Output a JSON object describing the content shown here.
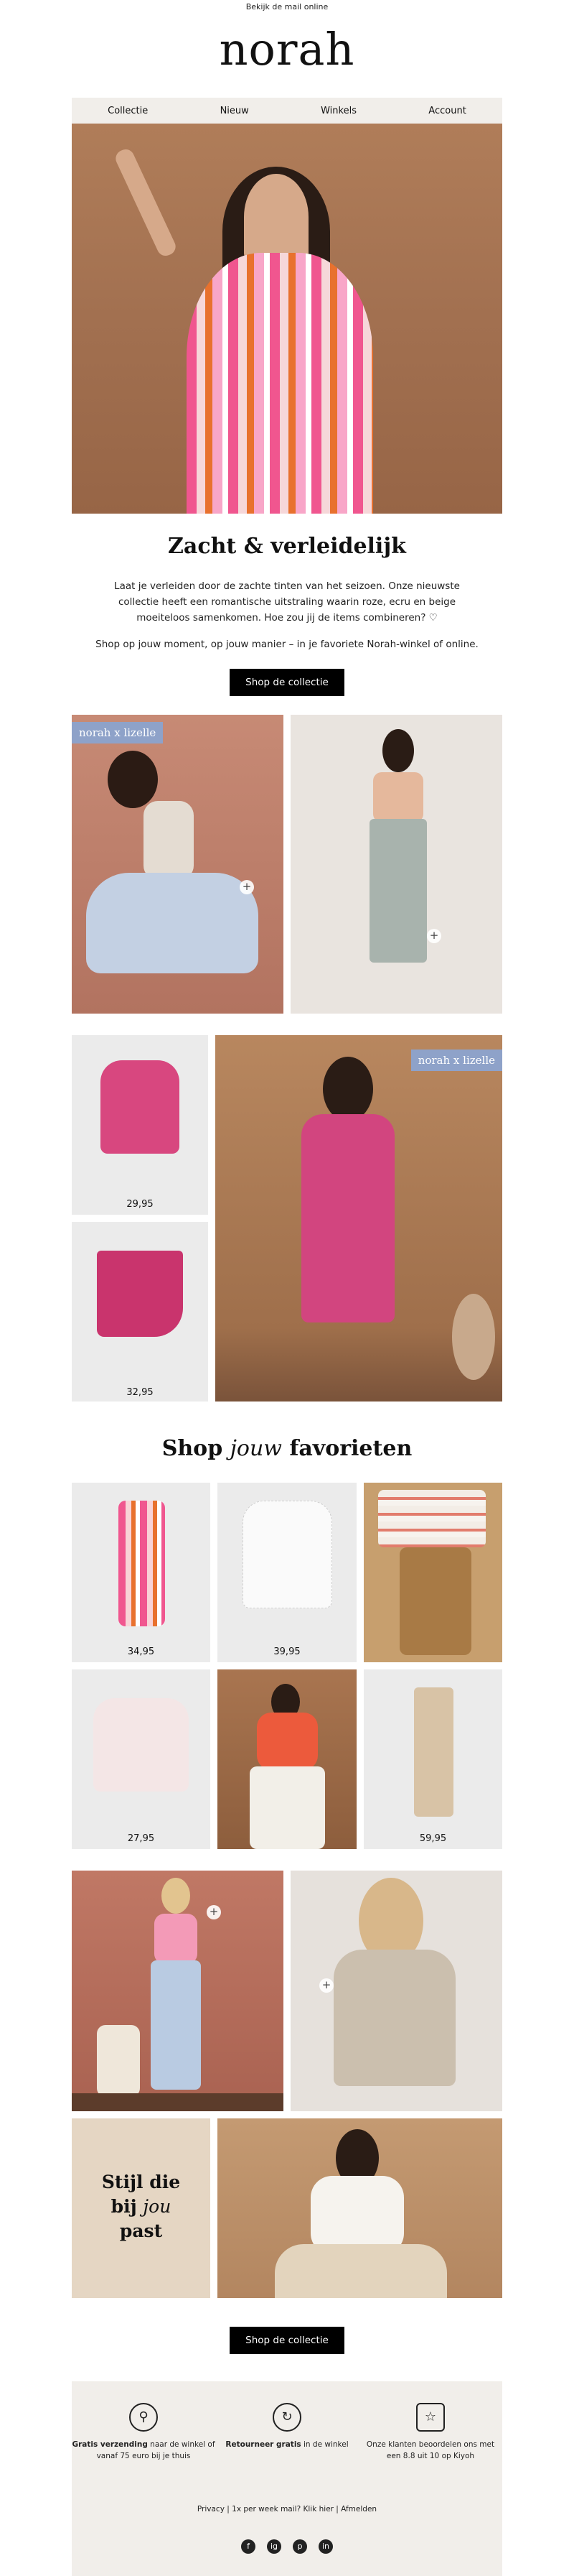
{
  "topline": "Bekijk de mail online",
  "logo": "norah",
  "nav": [
    "Collectie",
    "Nieuw",
    "Winkels",
    "Account"
  ],
  "hero_title": "Zacht & verleidelijk",
  "intro": "Laat je verleiden door de zachte tinten van het seizoen. Onze nieuwste collectie heeft een romantische uitstraling waarin roze, ecru en beige moeiteloos samenkomen. Hoe zou jij de items combineren? ♡",
  "intro2": "Shop op jouw moment, op jouw manier – in je favoriete Norah-winkel of online.",
  "cta1": "Shop de collectie",
  "badge": "norah x lizelle",
  "prices_pair": [
    "29,95",
    "32,95"
  ],
  "fav_title_a": "Shop ",
  "fav_title_em": "jouw",
  "fav_title_b": " favorieten",
  "fav_prices": [
    "34,95",
    "39,95",
    "27,95",
    "59,95"
  ],
  "quote_a": "Stijl die",
  "quote_b": "bij ",
  "quote_em": "jou",
  "quote_c": "past",
  "cta2": "Shop de collectie",
  "usp": [
    {
      "bold": "Gratis verzending",
      "rest": " naar de winkel of vanaf 75 euro bij je thuis"
    },
    {
      "bold": "Retourneer gratis",
      "rest": " in de winkel"
    },
    {
      "bold": "",
      "rest": "Onze klanten beoordelen ons met een 8.8 uit 10 op Kiyoh"
    }
  ],
  "footer_links": "Privacy | 1x per week mail? Klik hier | Afmelden",
  "social": [
    "f",
    "ig",
    "p",
    "in"
  ],
  "colors": {
    "nav_bg": "#f1eeea",
    "badge": "#8ea2c9",
    "cta": "#000000"
  }
}
